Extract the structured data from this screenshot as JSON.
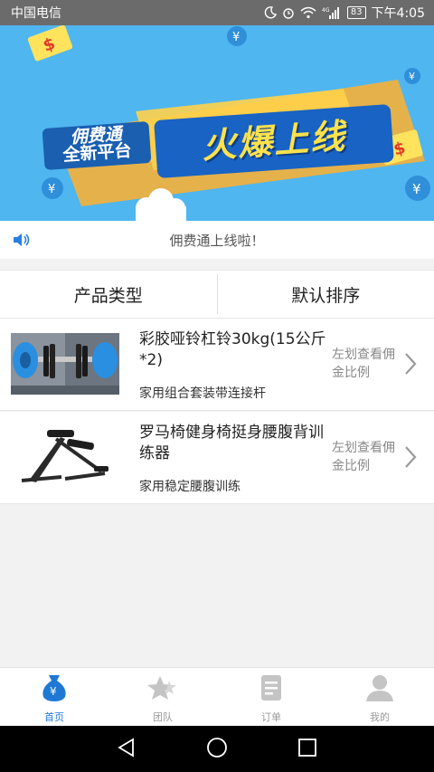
{
  "status_bar": {
    "carrier": "中国电信",
    "network": "4G",
    "battery": "83",
    "time": "下午4:05"
  },
  "banner": {
    "tag_line1": "佣费通",
    "tag_line2": "全新平台",
    "headline": "火爆上线"
  },
  "notice": {
    "text": "佣费通上线啦！"
  },
  "filter": {
    "type_label": "产品类型",
    "sort_label": "默认排序"
  },
  "products": [
    {
      "title": "彩胶哑铃杠铃30kg(15公斤*2)",
      "subtitle": "家用组合套装带连接杆",
      "hint": "左划查看佣金比例"
    },
    {
      "title": "罗马椅健身椅挺身腰腹背训练器",
      "subtitle": "家用稳定腰腹训练",
      "hint": "左划查看佣金比例"
    }
  ],
  "tabs": [
    {
      "label": "首页",
      "icon": "money-bag-icon",
      "active": true
    },
    {
      "label": "团队",
      "icon": "star-team-icon",
      "active": false
    },
    {
      "label": "订单",
      "icon": "order-document-icon",
      "active": false
    },
    {
      "label": "我的",
      "icon": "user-profile-icon",
      "active": false
    }
  ],
  "colors": {
    "accent": "#1e78d4",
    "banner_bg": "#4fb6f0",
    "headline": "#ffe14b"
  }
}
